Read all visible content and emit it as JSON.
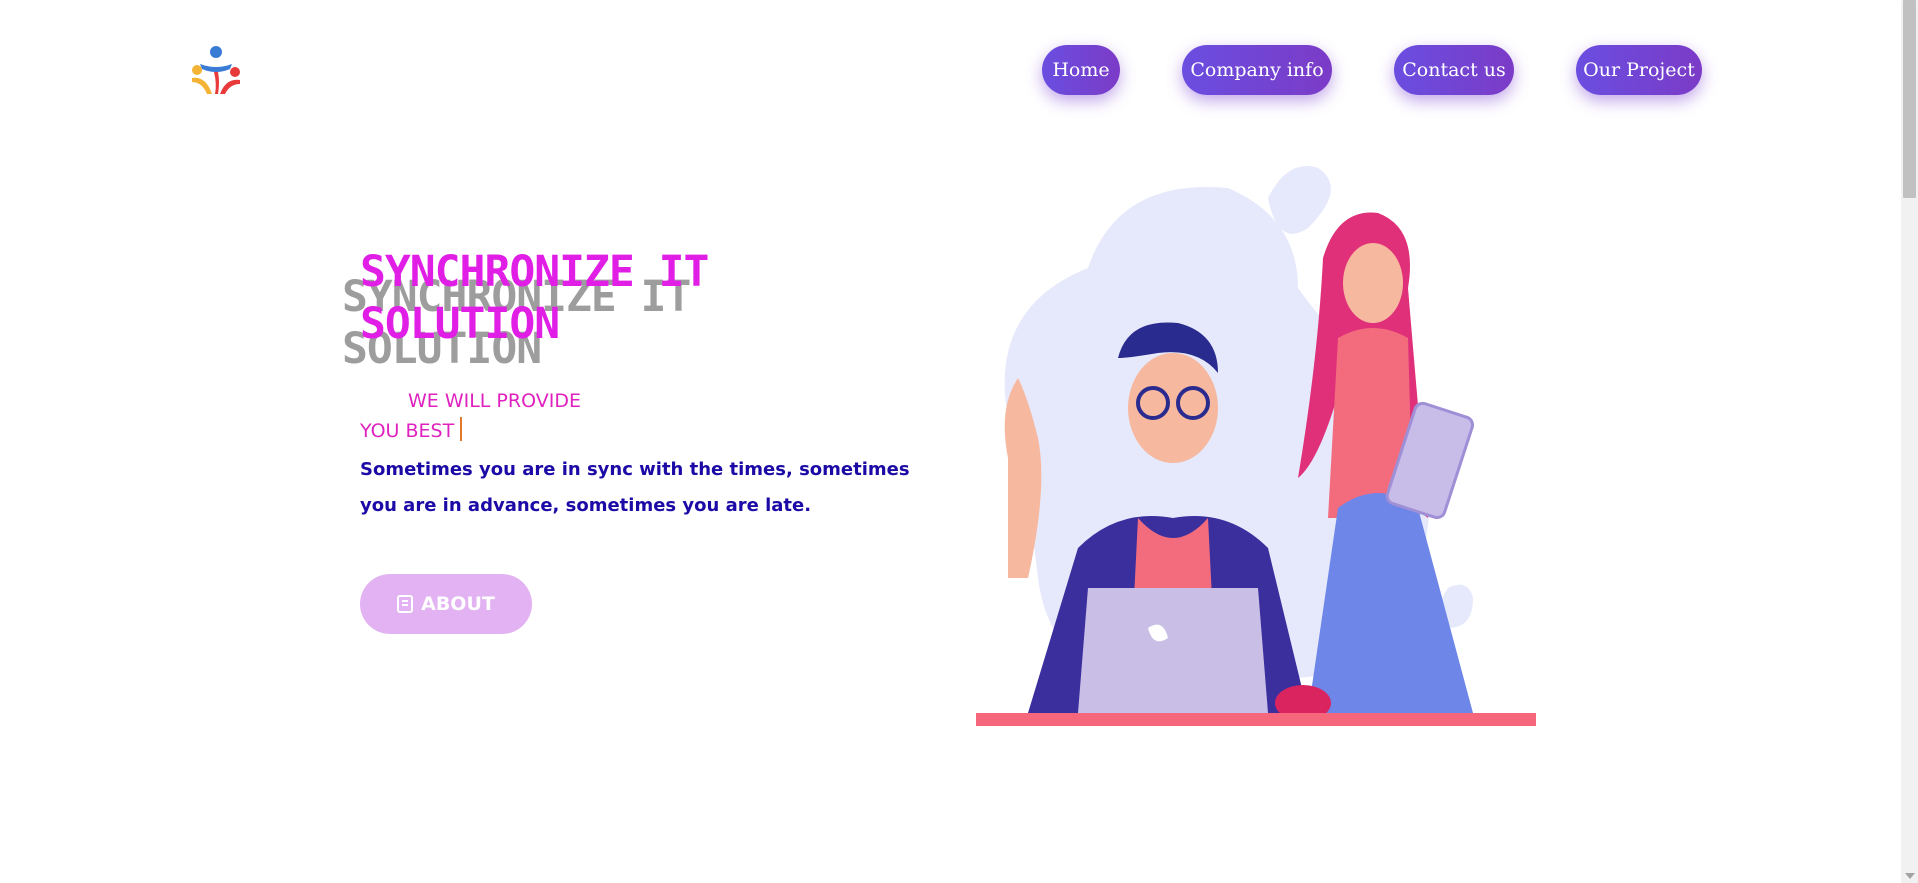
{
  "nav": {
    "home": "Home",
    "company": "Company info",
    "contact": "Contact us",
    "project": "Our Project"
  },
  "hero": {
    "title_line1": "SYNCHRONIZE IT",
    "title_line2": "SOLUTION",
    "tagline_line1": "WE WILL PROVIDE",
    "tagline_line2": "YOU BEST",
    "description": "Sometimes you are in sync with the times, sometimes you are in advance, sometimes you are late.",
    "about_button": "ABOUT"
  },
  "colors": {
    "nav_gradient_start": "#6a4ee0",
    "nav_gradient_end": "#7b3bc7",
    "title": "#e01ee6",
    "title_shadow": "#9d9d9d",
    "tagline": "#df22bf",
    "description": "#1c0aa6",
    "about_button": "#e2b2f2"
  },
  "icons": {
    "logo": "people-logo-icon",
    "about": "document-icon"
  }
}
